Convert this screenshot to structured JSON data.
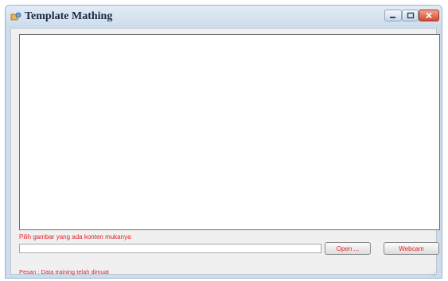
{
  "window": {
    "title": "Template Mathing",
    "icon": "app-icon",
    "controls": [
      "minimize-icon",
      "maximize-icon",
      "close-icon"
    ]
  },
  "form": {
    "picture_label": "Pilih gambar yang ada konten mukanya",
    "path_value": "",
    "open_label": "Open ...",
    "webcam_label": "Webcam",
    "status": "Pesan : Data training telah dimuat"
  },
  "colors": {
    "accent_text": "#e0242b",
    "window_frame": "#cfdcec",
    "client_bg": "#f0f0f0",
    "close_button": "#d44a33"
  }
}
